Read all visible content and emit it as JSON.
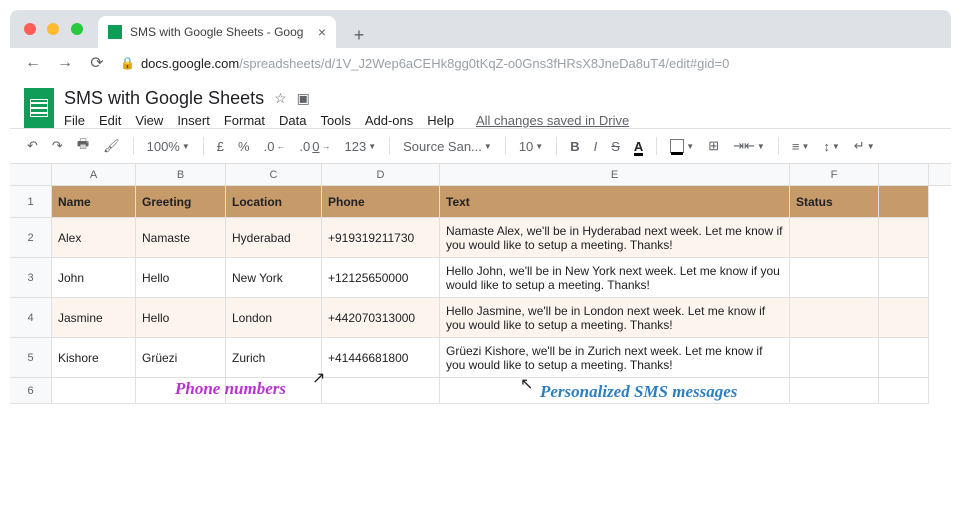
{
  "browser": {
    "tab_title": "SMS with Google Sheets - Goog",
    "url_domain": "docs.google.com",
    "url_path": "/spreadsheets/d/1V_J2Wep6aCEHk8gg0tKqZ-o0Gns3fHRsX8JneDa8uT4/edit#gid=0"
  },
  "doc": {
    "title": "SMS with Google Sheets",
    "saved": "All changes saved in Drive",
    "menus": [
      "File",
      "Edit",
      "View",
      "Insert",
      "Format",
      "Data",
      "Tools",
      "Add-ons",
      "Help"
    ]
  },
  "toolbar": {
    "zoom": "100%",
    "currency": "£",
    "percent": "%",
    "dec_dec": ".0",
    "dec_inc": ".00",
    "format": "123",
    "font": "Source San...",
    "fontsize": "10"
  },
  "columns": [
    "A",
    "B",
    "C",
    "D",
    "E",
    "F"
  ],
  "headers": {
    "A": "Name",
    "B": "Greeting",
    "C": "Location",
    "D": "Phone",
    "E": "Text",
    "F": "Status"
  },
  "rows": [
    {
      "n": "2",
      "A": "Alex",
      "B": "Namaste",
      "C": "Hyderabad",
      "D": "+919319211730",
      "E": "Namaste Alex, we'll be in Hyderabad next week. Let me know if you would like to setup a meeting. Thanks!",
      "F": ""
    },
    {
      "n": "3",
      "A": "John",
      "B": "Hello",
      "C": "New York",
      "D": "+12125650000",
      "E": "Hello John, we'll be in New York next week. Let me know if you would like to setup a meeting. Thanks!",
      "F": ""
    },
    {
      "n": "4",
      "A": "Jasmine",
      "B": "Hello",
      "C": "London",
      "D": "+442070313000",
      "E": "Hello Jasmine, we'll be in London next week. Let me know if you would like to setup a meeting. Thanks!",
      "F": ""
    },
    {
      "n": "5",
      "A": "Kishore",
      "B": "Grüezi",
      "C": "Zurich",
      "D": "+41446681800",
      "E": "Grüezi Kishore, we'll be in Zurich next week. Let me know if you would like to setup a meeting. Thanks!",
      "F": ""
    }
  ],
  "annot": {
    "phones": "Phone numbers",
    "sms": "Personalized SMS messages"
  }
}
